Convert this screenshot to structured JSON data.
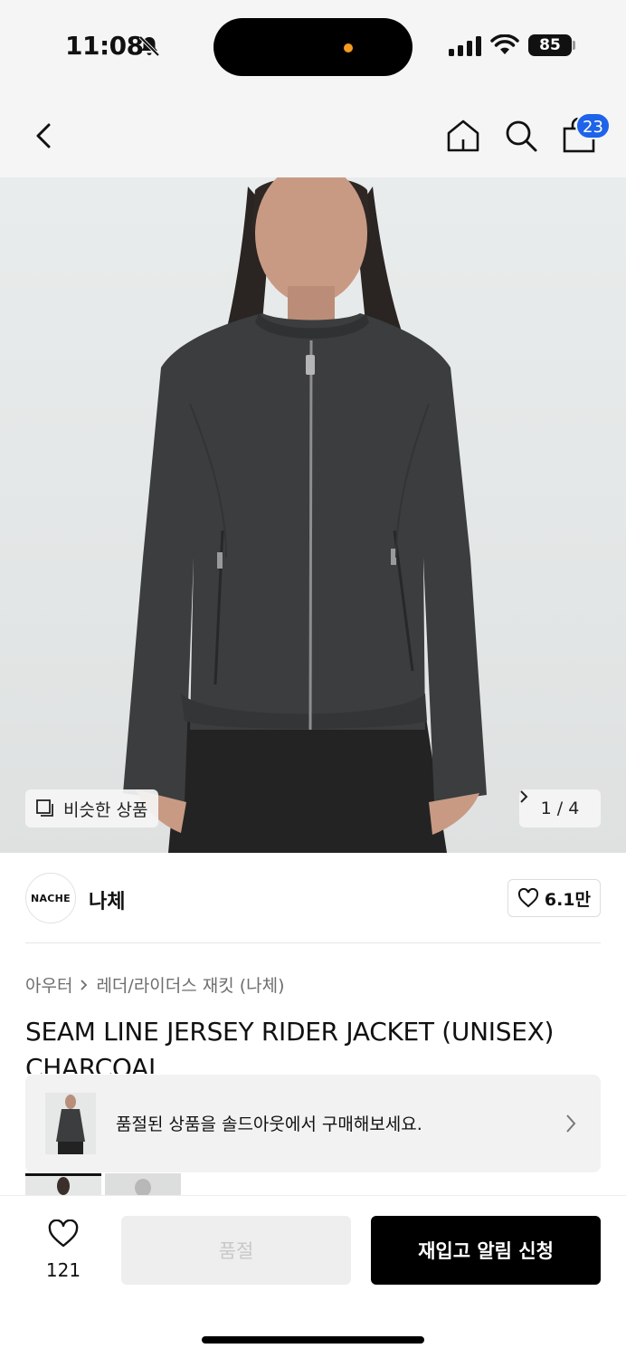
{
  "status_bar": {
    "time": "11:08",
    "battery": "85",
    "icons": [
      "bell-slash-icon",
      "cellular-signal-icon",
      "wifi-icon",
      "battery-icon"
    ]
  },
  "nav": {
    "icons": [
      "chevron-left-icon",
      "home-icon",
      "search-icon",
      "shopping-bag-icon"
    ],
    "cart_count": "23",
    "badge_color": "#1e63e9"
  },
  "hero": {
    "similar_label": "비슷한 상품",
    "page_indicator": "1 / 4"
  },
  "brand": {
    "logo_text": "NACHE",
    "name": "나체",
    "likes": "6.1만"
  },
  "breadcrumb": {
    "category": "아우터",
    "subcategory": "레더/라이더스 재킷 (나체)"
  },
  "product": {
    "title": "SEAM LINE JERSEY RIDER JACKET (UNISEX) CHARCOAL"
  },
  "soldout_banner": {
    "text": "품절된 상품을 솔드아웃에서 구매해보세요."
  },
  "bottom_bar": {
    "wish_count": "121",
    "soldout_label": "품절",
    "restock_label": "재입고 알림 신청"
  }
}
